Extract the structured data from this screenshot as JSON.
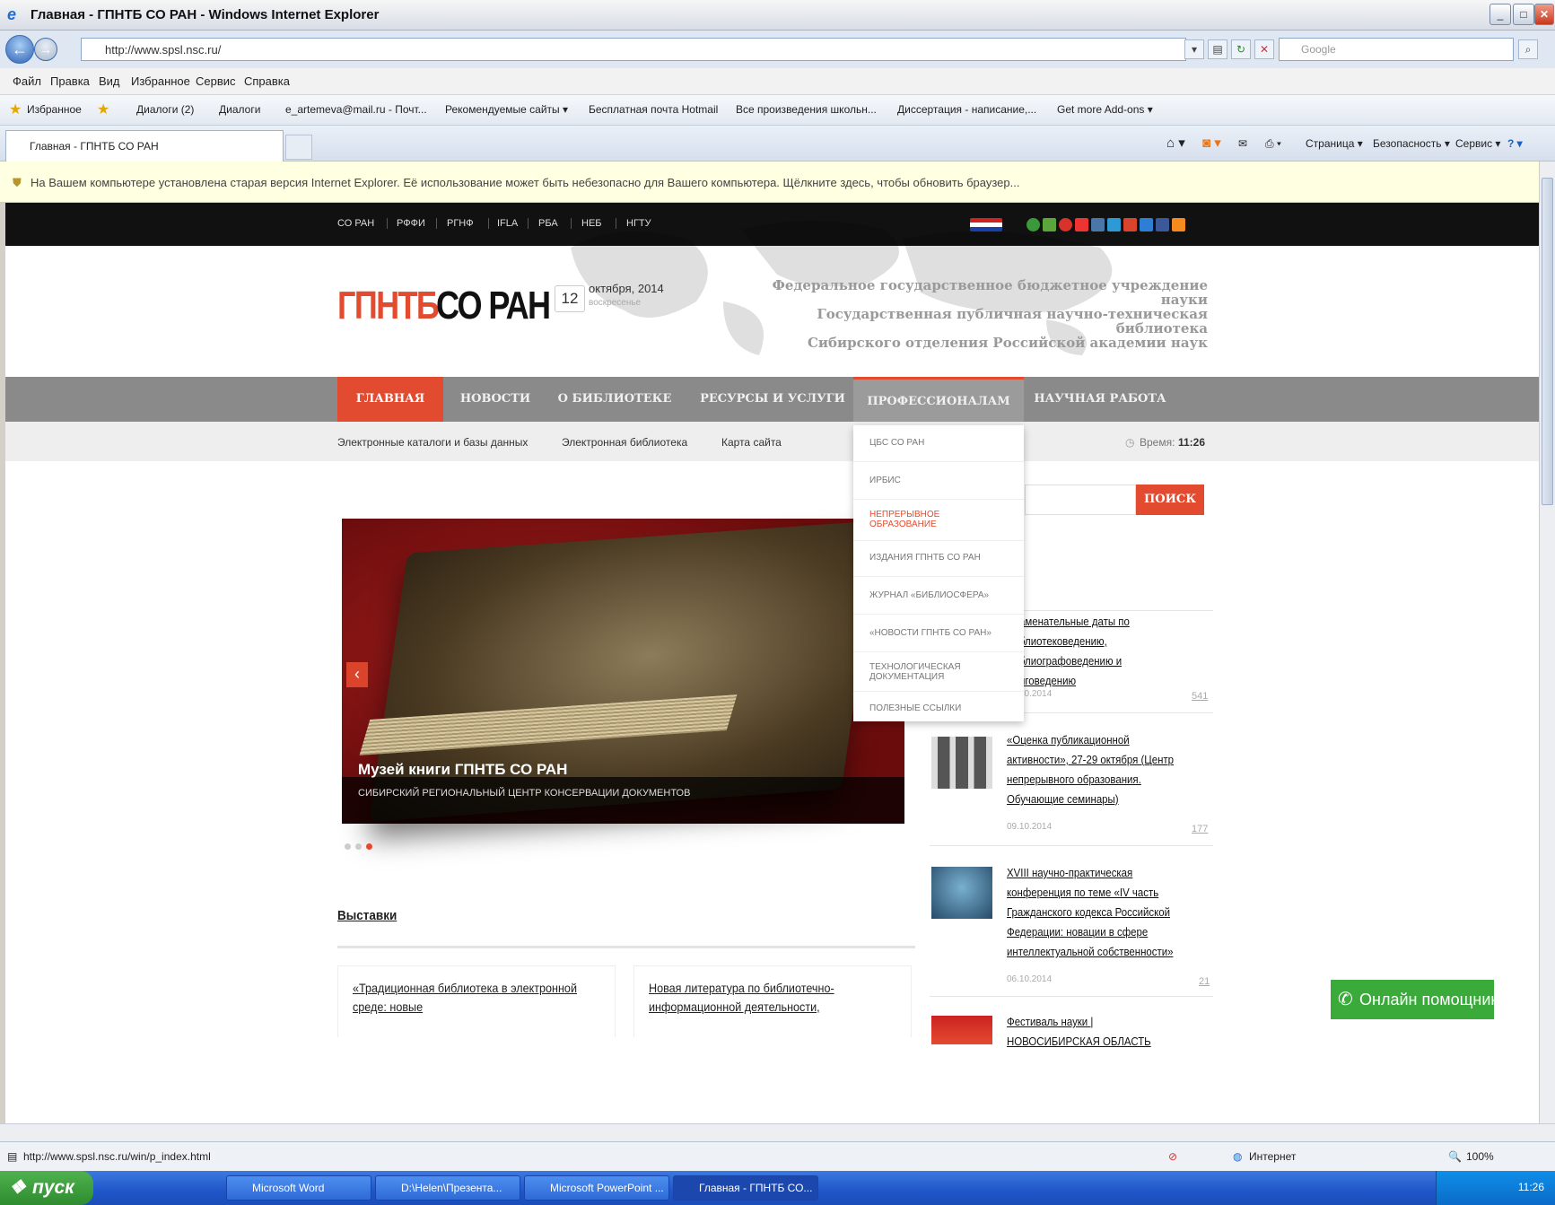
{
  "window": {
    "title": "Главная - ГПНТБ СО РАН - Windows Internet Explorer",
    "address": "http://www.spsl.nsc.ru/",
    "search_placeholder": "Google",
    "menu": [
      "Файл",
      "Правка",
      "Вид",
      "Избранное",
      "Сервис",
      "Справка"
    ],
    "favorites_label": "Избранное",
    "favorites": [
      "Диалоги (2)",
      "Диалоги",
      "e_artemeva@mail.ru - Почт...",
      "Рекомендуемые сайты ▾",
      "Бесплатная почта Hotmail",
      "Все произведения школьн...",
      "Диссертация - написание,...",
      "Get more Add-ons ▾"
    ],
    "tab_title": "Главная - ГПНТБ СО РАН",
    "commands": [
      "Страница ▾",
      "Безопасность ▾",
      "Сервис ▾"
    ],
    "infobar": "На Вашем компьютере установлена старая версия Internet Explorer. Её использование может быть небезопасно для Вашего компьютера. Щёлкните здесь, чтобы обновить браузер...",
    "status_url": "http://www.spsl.nsc.ru/win/p_index.html",
    "status_zone": "Интернет",
    "zoom": "100%"
  },
  "taskbar": {
    "start": "пуск",
    "tasks": [
      "Microsoft Word",
      "D:\\Helen\\Презента...",
      "Microsoft PowerPoint ...",
      "Главная - ГПНТБ СО..."
    ],
    "clock": "11:26"
  },
  "site": {
    "top_links": [
      "СО РАН",
      "РФФИ",
      "РГНФ",
      "IFLA",
      "РБА",
      "НЕБ",
      "НГТУ"
    ],
    "logo_red": "ГПНТБ",
    "logo_black": "СО РАН",
    "day": "12",
    "month": "октября, 2014",
    "weekday": "воскресенье",
    "fed_lines": [
      "Федеральное государственное бюджетное учреждение науки",
      "Государственная публичная научно-техническая библиотека",
      "Сибирского отделения Российской академии наук"
    ],
    "nav": [
      "Главная",
      "Новости",
      "О библиотеке",
      "Ресурсы и услуги",
      "Профессионалам",
      "Научная работа"
    ],
    "subnav": [
      "Электронные каталоги и базы данных",
      "Электронная библиотека",
      "Карта сайта"
    ],
    "time_label": "Время:",
    "time_value": "11:26",
    "dropdown": [
      "ЦБС СО РАН",
      "ИРБИС",
      "Непрерывное образование",
      "Издания ГПНТБ СО РАН",
      "Журнал «Библиосфера»",
      "«Новости ГПНТБ СО РАН»",
      "Технологическая документация",
      "Полезные ссылки"
    ],
    "search_button": "Поиск",
    "slide_title": "Музей книги ГПНТБ СО РАН",
    "slide_subtitle": "Сибирский региональный центр консервации документов",
    "slider_prev": "‹",
    "news": [
      {
        "text": "аменательные даты по блиотековедению, блиографоведению и иговедению",
        "date": "10.2014",
        "views": "541"
      },
      {
        "text": "«Оценка публикационной активности», 27-29 октября (Центр непрерывного образования. Обучающие семинары)",
        "date": "09.10.2014",
        "views": "177"
      },
      {
        "text": "XVIII научно-практическая конференция по теме «IV часть Гражданского кодекса Российской Федерации: новации в сфере интеллектуальной собственности»",
        "date": "06.10.2014",
        "views": "21"
      },
      {
        "text": "Фестиваль науки | НОВОСИБИРСКАЯ ОБЛАСТЬ",
        "date": "",
        "views": ""
      }
    ],
    "section_title": "Выставки",
    "cards": [
      "«Традиционная библиотека в электронной среде: новые",
      "Новая литература по библиотечно-информационной деятельности,"
    ],
    "helper": "Онлайн помощник"
  },
  "colors": {
    "accent": "#e34b30",
    "nav": "#8a8a8a",
    "helper": "#3aab3a"
  }
}
